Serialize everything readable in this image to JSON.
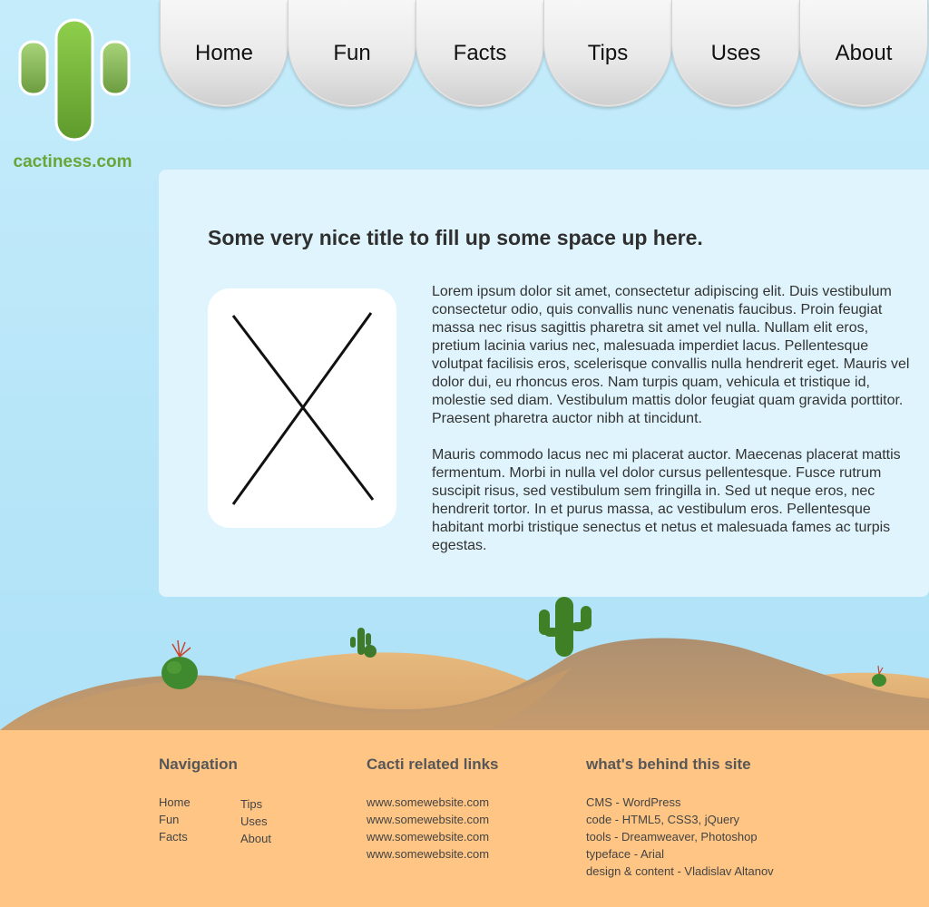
{
  "logo": {
    "text": "cactiness.com",
    "icon": "cactus-logo-icon",
    "color": "#6aa53a"
  },
  "nav": {
    "items": [
      {
        "label": "Home"
      },
      {
        "label": "Fun"
      },
      {
        "label": "Facts"
      },
      {
        "label": "Tips"
      },
      {
        "label": "Uses"
      },
      {
        "label": "About"
      }
    ]
  },
  "main": {
    "title": "Some very nice title to fill up some space up here.",
    "image_placeholder_icon": "image-placeholder-x-icon",
    "paragraphs": [
      "Lorem ipsum dolor sit amet, consectetur adipiscing elit. Duis vestibulum consectetur odio, quis convallis nunc venenatis faucibus. Proin feugiat massa nec risus sagittis pharetra sit amet vel nulla. Nullam elit eros, pretium lacinia varius nec, malesuada imperdiet lacus. Pellentesque volutpat facilisis eros, scelerisque convallis nulla hendrerit eget. Mauris vel dolor dui, eu rhoncus eros. Nam turpis quam, vehicula et tristique id, molestie sed diam. Vestibulum mattis dolor feugiat quam gravida porttitor. Praesent pharetra auctor nibh at tincidunt.",
      "Mauris commodo lacus nec mi placerat auctor. Maecenas placerat mattis fermentum. Morbi in nulla vel dolor cursus pellentesque. Fusce rutrum suscipit risus, sed vestibulum sem fringilla in. Sed ut neque eros, nec hendrerit tortor. In et purus massa, ac vestibulum eros. Pellentesque habitant morbi tristique senectus et netus et malesuada fames ac turpis egestas."
    ]
  },
  "footer": {
    "navigation": {
      "heading": "Navigation",
      "col1": [
        "Home",
        "Fun",
        "Facts"
      ],
      "col2": [
        "Tips",
        "Uses",
        "About"
      ]
    },
    "links": {
      "heading": "Cacti related links",
      "items": [
        "www.somewebsite.com",
        "www.somewebsite.com",
        "www.somewebsite.com",
        "www.somewebsite.com"
      ]
    },
    "behind": {
      "heading": "what's behind this site",
      "items": [
        "CMS - WordPress",
        "code - HTML5, CSS3, jQuery",
        "tools - Dreamweaver, Photoshop",
        "typeface - Arial",
        "design & content - Vladislav Altanov"
      ]
    }
  },
  "colors": {
    "sky": "#b4e4f8",
    "panel": "#dff4fc",
    "sand": "#e7b27a",
    "footer": "#fec584",
    "cactus": "#4f8a2b"
  }
}
